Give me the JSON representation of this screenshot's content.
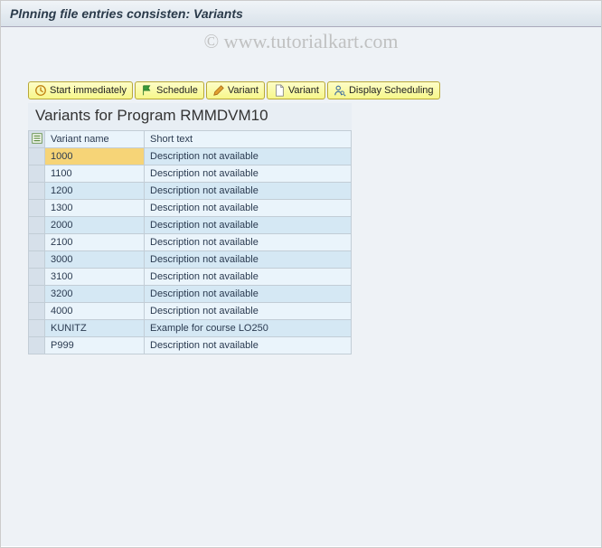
{
  "window": {
    "title": "Plnning file entries consisten: Variants"
  },
  "watermark": "© www.tutorialkart.com",
  "toolbar": {
    "start_immediately": "Start immediately",
    "schedule": "Schedule",
    "variant_edit": "Variant",
    "variant_new": "Variant",
    "display_scheduling": "Display Scheduling"
  },
  "panel": {
    "title": "Variants for Program RMMDVM10"
  },
  "table": {
    "columns": {
      "variant_name": "Variant name",
      "short_text": "Short text"
    },
    "rows": [
      {
        "variant": "1000",
        "short_text": "Description not available",
        "selected": true
      },
      {
        "variant": "1100",
        "short_text": "Description not available",
        "selected": false
      },
      {
        "variant": "1200",
        "short_text": "Description not available",
        "selected": false
      },
      {
        "variant": "1300",
        "short_text": "Description not available",
        "selected": false
      },
      {
        "variant": "2000",
        "short_text": "Description not available",
        "selected": false
      },
      {
        "variant": "2100",
        "short_text": "Description not available",
        "selected": false
      },
      {
        "variant": "3000",
        "short_text": "Description not available",
        "selected": false
      },
      {
        "variant": "3100",
        "short_text": "Description not available",
        "selected": false
      },
      {
        "variant": "3200",
        "short_text": "Description not available",
        "selected": false
      },
      {
        "variant": "4000",
        "short_text": "Description not available",
        "selected": false
      },
      {
        "variant": "KUNITZ",
        "short_text": "Example for course LO250",
        "selected": false
      },
      {
        "variant": "P999",
        "short_text": "Description not available",
        "selected": false
      }
    ]
  }
}
